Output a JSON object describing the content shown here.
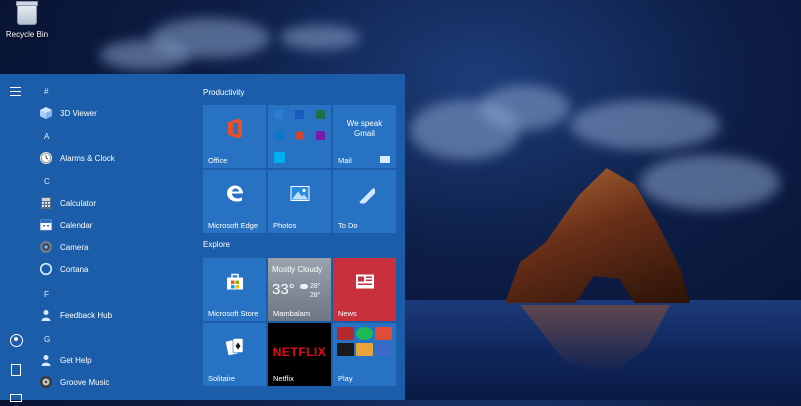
{
  "desktop": {
    "recycle_bin_label": "Recycle Bin"
  },
  "start_menu": {
    "app_list": [
      {
        "type": "header",
        "label": "#"
      },
      {
        "type": "app",
        "label": "3D Viewer",
        "icon": "cube-icon"
      },
      {
        "type": "header",
        "label": "A"
      },
      {
        "type": "app",
        "label": "Alarms & Clock",
        "icon": "clock-icon"
      },
      {
        "type": "header",
        "label": "C"
      },
      {
        "type": "app",
        "label": "Calculator",
        "icon": "calculator-icon"
      },
      {
        "type": "app",
        "label": "Calendar",
        "icon": "calendar-icon"
      },
      {
        "type": "app",
        "label": "Camera",
        "icon": "camera-icon"
      },
      {
        "type": "app",
        "label": "Cortana",
        "icon": "cortana-icon"
      },
      {
        "type": "header",
        "label": "F"
      },
      {
        "type": "app",
        "label": "Feedback Hub",
        "icon": "feedback-icon"
      },
      {
        "type": "header",
        "label": "G"
      },
      {
        "type": "app",
        "label": "Get Help",
        "icon": "help-icon"
      },
      {
        "type": "app",
        "label": "Groove Music",
        "icon": "music-icon"
      }
    ],
    "groups": {
      "productivity": "Productivity",
      "explore": "Explore"
    },
    "tiles": {
      "office": "Office",
      "mail_title": "We speak Gmail",
      "mail": "Mail",
      "edge": "Microsoft Edge",
      "photos": "Photos",
      "todo": "To Do",
      "store": "Microsoft Store",
      "weather_condition": "Mostly Cloudy",
      "weather_temp": "33°",
      "weather_high": "28°",
      "weather_low": "28°",
      "weather_location": "Mambalam",
      "news": "News",
      "solitaire": "Solitaire",
      "netflix_logo": "NETFLIX",
      "netflix": "Netflix",
      "play": "Play"
    }
  },
  "colors": {
    "menu_bg": "#1b5da8",
    "tile_bg": "#2772c2",
    "netflix_red": "#e50914"
  }
}
